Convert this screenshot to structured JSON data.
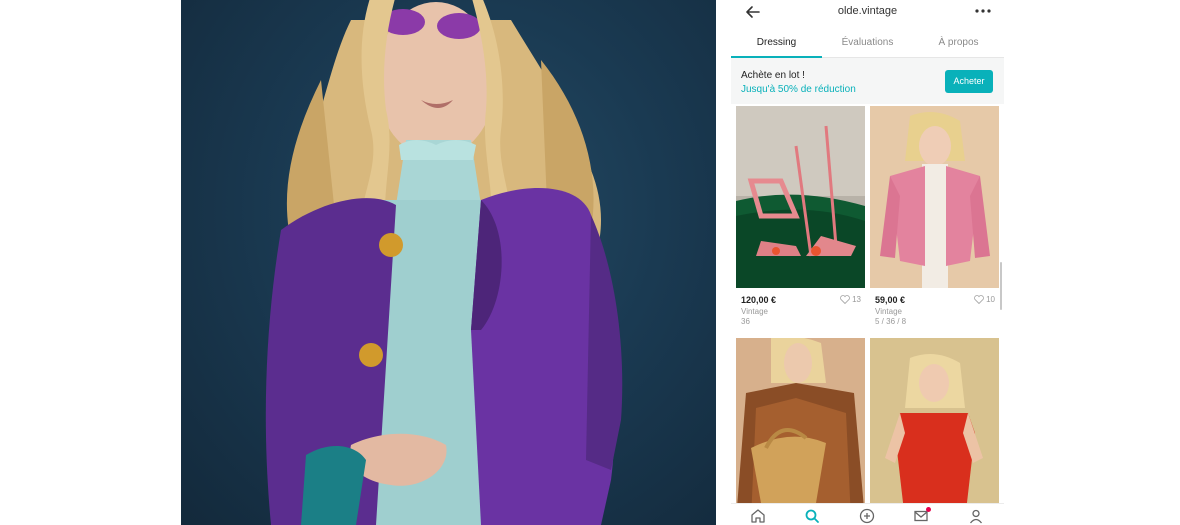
{
  "colors": {
    "accent": "#09b1ba",
    "notification": "#e5004b"
  },
  "header": {
    "username": "olde.vintage",
    "back_icon": "arrow-left",
    "more_icon": "ellipsis"
  },
  "tabs": [
    {
      "label": "Dressing",
      "active": true
    },
    {
      "label": "Évaluations",
      "active": false
    },
    {
      "label": "À propos",
      "active": false
    }
  ],
  "promo": {
    "title": "Achète en lot !",
    "subtitle": "Jusqu'à 50% de réduction",
    "button": "Acheter"
  },
  "items": [
    {
      "price": "120,00 €",
      "likes": "13",
      "brand": "Vintage",
      "size": "36"
    },
    {
      "price": "59,00 €",
      "likes": "10",
      "brand": "Vintage",
      "size": "5 / 36 / 8"
    },
    {},
    {}
  ],
  "bottom_nav": [
    {
      "icon": "home-icon"
    },
    {
      "icon": "search-icon",
      "active": true
    },
    {
      "icon": "plus-circle-icon"
    },
    {
      "icon": "mail-icon",
      "notification": true
    },
    {
      "icon": "profile-icon"
    }
  ]
}
